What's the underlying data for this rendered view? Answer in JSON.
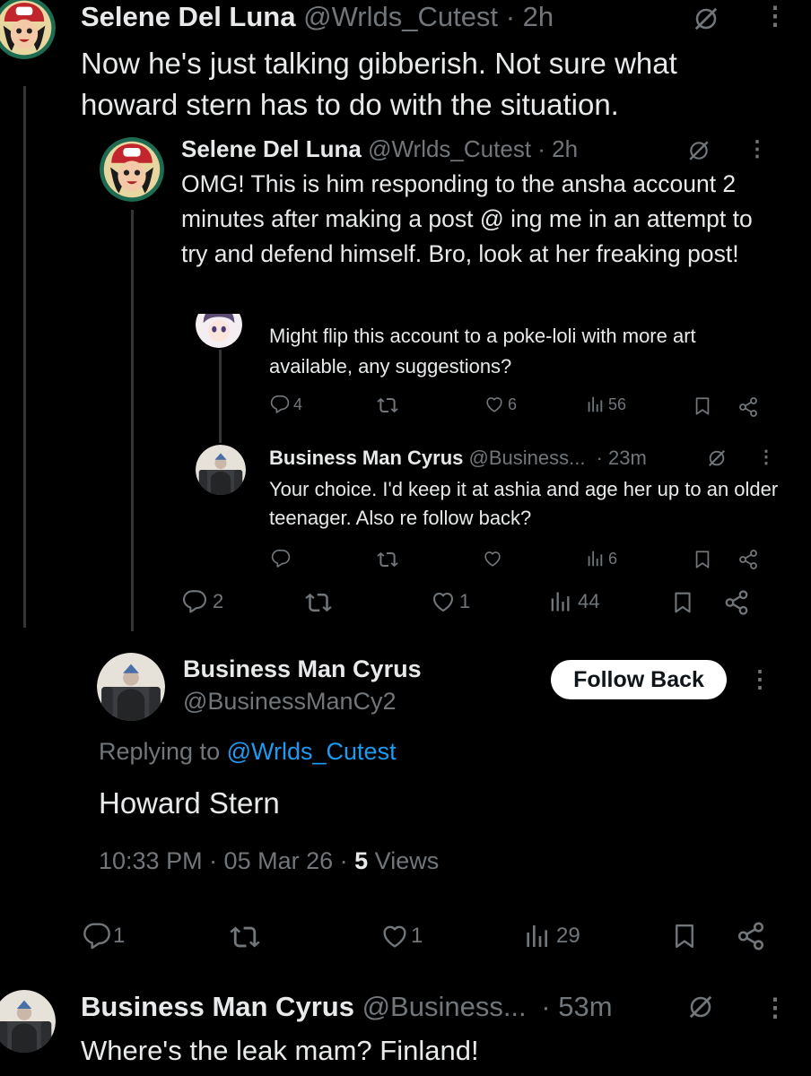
{
  "top_tweet": {
    "name": "Selene Del Luna",
    "handle": "@Wrlds_Cutest",
    "time": "· 2h",
    "text": "Now he's just talking gibberish. Not sure what howard stern has to do with the situation."
  },
  "quoted_tweet": {
    "name": "Selene Del Luna",
    "handle": "@Wrlds_Cutest",
    "time": "· 2h",
    "text": "OMG! This is him responding to the ansha account 2 minutes after making a post @ ing me in an attempt to try and defend himself. Bro, look at her freaking post!",
    "stats": {
      "replies": "2",
      "reposts": "",
      "likes": "1",
      "views": "44"
    }
  },
  "inner_post_1": {
    "text": "Might flip this account to a poke-loli with more art available, any suggestions?",
    "stats": {
      "replies": "4",
      "reposts": "",
      "likes": "6",
      "views": "56"
    }
  },
  "inner_post_2": {
    "name": "Business Man Cyrus",
    "handle": "@Business...",
    "time": "· 23m",
    "text": "Your choice. I'd keep it at ashia and age her up to an older teenager. Also re follow back?",
    "stats": {
      "replies": "",
      "reposts": "",
      "likes": "",
      "views": "6"
    }
  },
  "main_tweet": {
    "name": "Business Man Cyrus",
    "handle": "@BusinessManCy2",
    "follow_label": "Follow Back",
    "replying_prefix": "Replying to",
    "replying_handle": "@Wrlds_Cutest",
    "text": "Howard Stern",
    "timestamp": "10:33 PM · 05 Mar 26 · ",
    "views_count": "5",
    "views_label": "Views",
    "stats": {
      "replies": "1",
      "reposts": "",
      "likes": "1",
      "views": "29"
    }
  },
  "bottom_tweet": {
    "name": "Business Man Cyrus",
    "handle": "@Business...",
    "time": "· 53m",
    "text": "Where's the leak mam? Finland!"
  },
  "colors": {
    "background": "#000000",
    "text": "#e7e9ea",
    "muted": "#71767b",
    "link": "#1d9bf0",
    "thread_line": "#333639"
  },
  "icons": [
    "reply-icon",
    "repost-icon",
    "like-icon",
    "views-icon",
    "bookmark-icon",
    "share-icon",
    "grok-icon",
    "more-icon"
  ]
}
